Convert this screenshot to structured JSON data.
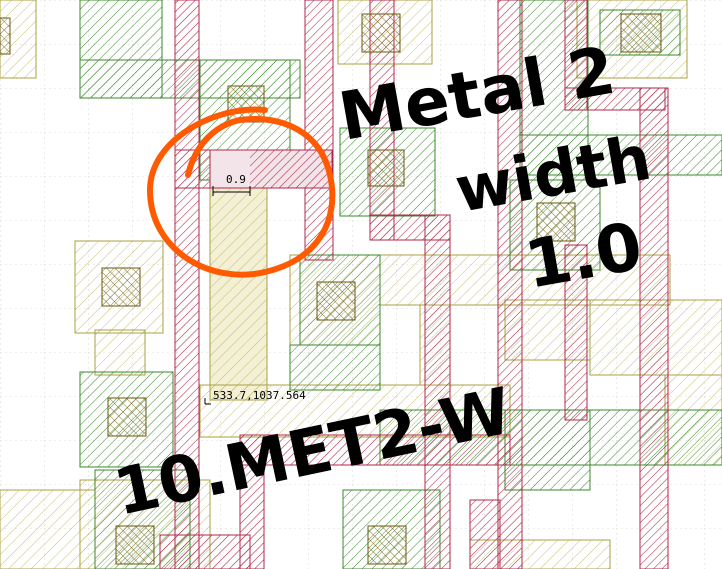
{
  "window": {
    "view": "layout-editor-canvas"
  },
  "colors": {
    "background": "#ffffff",
    "grid": "#b8b8b8",
    "metal_red": "#b0284a",
    "metal_green": "#3a8a2a",
    "via_fill_green": "#d6ecd0",
    "yellow_olive": "#a8a040",
    "yellow_fill": "#f3f0d6",
    "annotation_ink": "#000000",
    "highlight_circle": "#ff5a00"
  },
  "ruler": {
    "label": "0.9"
  },
  "cursor_readout": {
    "text": "533.7,1037.564"
  },
  "annotations": {
    "line1": "Metal 2",
    "line2": "width",
    "line3": "1.0",
    "rule_name": "10.MET2-W"
  }
}
